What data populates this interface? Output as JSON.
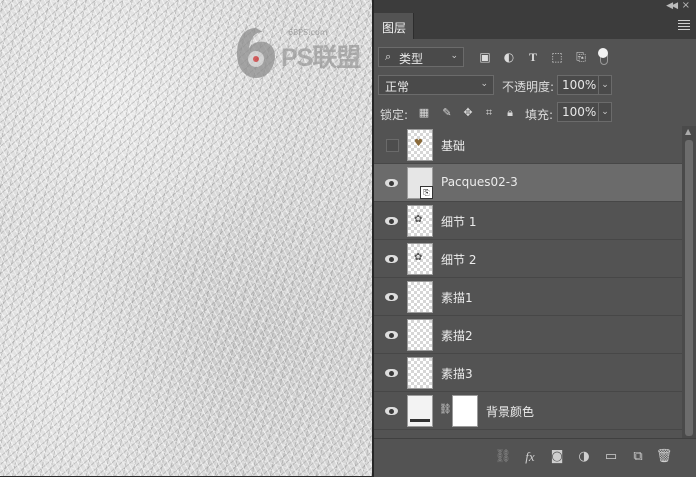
{
  "watermark": {
    "site": "68PS.com",
    "brand": "PS联盟"
  },
  "panel": {
    "tab_label": "图层",
    "filter": {
      "selected": "类型",
      "search_icon": "search-icon"
    },
    "filter_icons": [
      "image-filter-icon",
      "adjustment-filter-icon",
      "type-filter-icon",
      "shape-filter-icon",
      "smart-object-filter-icon"
    ],
    "blend_mode": "正常",
    "opacity_label": "不透明度:",
    "opacity_value": "100%",
    "lock_label": "锁定:",
    "fill_label": "填充:",
    "fill_value": "100%",
    "lock_icons": [
      "lock-transparent-icon",
      "lock-paint-icon",
      "lock-position-icon",
      "lock-artboard-icon",
      "lock-all-icon"
    ]
  },
  "layers": [
    {
      "name": "基础",
      "visible": false,
      "kind": "pixel",
      "selected": false
    },
    {
      "name": "Pacques02-3",
      "visible": true,
      "kind": "smart",
      "selected": true
    },
    {
      "name": "细节 1",
      "visible": true,
      "kind": "pixel",
      "selected": false
    },
    {
      "name": "细节 2",
      "visible": true,
      "kind": "pixel",
      "selected": false
    },
    {
      "name": "素描1",
      "visible": true,
      "kind": "pixel",
      "selected": false
    },
    {
      "name": "素描2",
      "visible": true,
      "kind": "pixel",
      "selected": false
    },
    {
      "name": "素描3",
      "visible": true,
      "kind": "pixel",
      "selected": false
    },
    {
      "name": "背景颜色",
      "visible": true,
      "kind": "fill",
      "selected": false
    }
  ],
  "footer_icons": [
    "link-layers-icon",
    "layer-style-fx-icon",
    "add-mask-icon",
    "adjustment-layer-icon",
    "new-group-icon",
    "new-layer-icon",
    "delete-layer-icon"
  ]
}
